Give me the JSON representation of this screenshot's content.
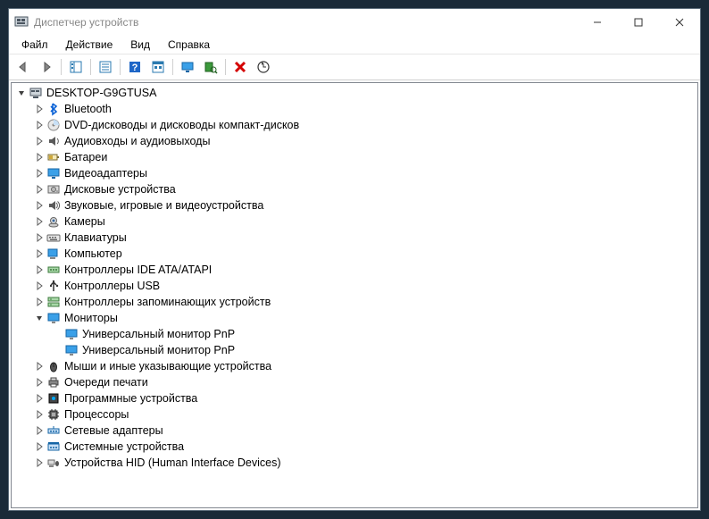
{
  "window": {
    "title": "Диспетчер устройств"
  },
  "menu": {
    "file": "Файл",
    "action": "Действие",
    "view": "Вид",
    "help": "Справка"
  },
  "toolbar": {
    "back": "back",
    "forward": "forward",
    "show_hide": "show-hide",
    "properties": "properties",
    "help": "help",
    "app_view": "app-view",
    "display": "display",
    "scan": "scan",
    "remove": "remove",
    "update": "update"
  },
  "tree": {
    "root": "DESKTOP-G9GTUSA",
    "items": [
      {
        "label": "Bluetooth",
        "icon": "bluetooth"
      },
      {
        "label": "DVD-дисководы и дисководы компакт-дисков",
        "icon": "disc"
      },
      {
        "label": "Аудиовходы и аудиовыходы",
        "icon": "audio-io"
      },
      {
        "label": "Батареи",
        "icon": "battery"
      },
      {
        "label": "Видеоадаптеры",
        "icon": "display-adapter"
      },
      {
        "label": "Дисковые устройства",
        "icon": "disk"
      },
      {
        "label": "Звуковые, игровые и видеоустройства",
        "icon": "sound"
      },
      {
        "label": "Камеры",
        "icon": "camera"
      },
      {
        "label": "Клавиатуры",
        "icon": "keyboard"
      },
      {
        "label": "Компьютер",
        "icon": "computer"
      },
      {
        "label": "Контроллеры IDE ATA/ATAPI",
        "icon": "ide"
      },
      {
        "label": "Контроллеры USB",
        "icon": "usb"
      },
      {
        "label": "Контроллеры запоминающих устройств",
        "icon": "storage-ctl"
      },
      {
        "label": "Мониторы",
        "icon": "monitor",
        "expanded": true,
        "children": [
          {
            "label": "Универсальный монитор PnP",
            "icon": "monitor"
          },
          {
            "label": "Универсальный монитор PnP",
            "icon": "monitor"
          }
        ]
      },
      {
        "label": "Мыши и иные указывающие устройства",
        "icon": "mouse"
      },
      {
        "label": "Очереди печати",
        "icon": "printer"
      },
      {
        "label": "Программные устройства",
        "icon": "software"
      },
      {
        "label": "Процессоры",
        "icon": "cpu"
      },
      {
        "label": "Сетевые адаптеры",
        "icon": "network"
      },
      {
        "label": "Системные устройства",
        "icon": "system"
      },
      {
        "label": "Устройства HID (Human Interface Devices)",
        "icon": "hid"
      }
    ]
  }
}
